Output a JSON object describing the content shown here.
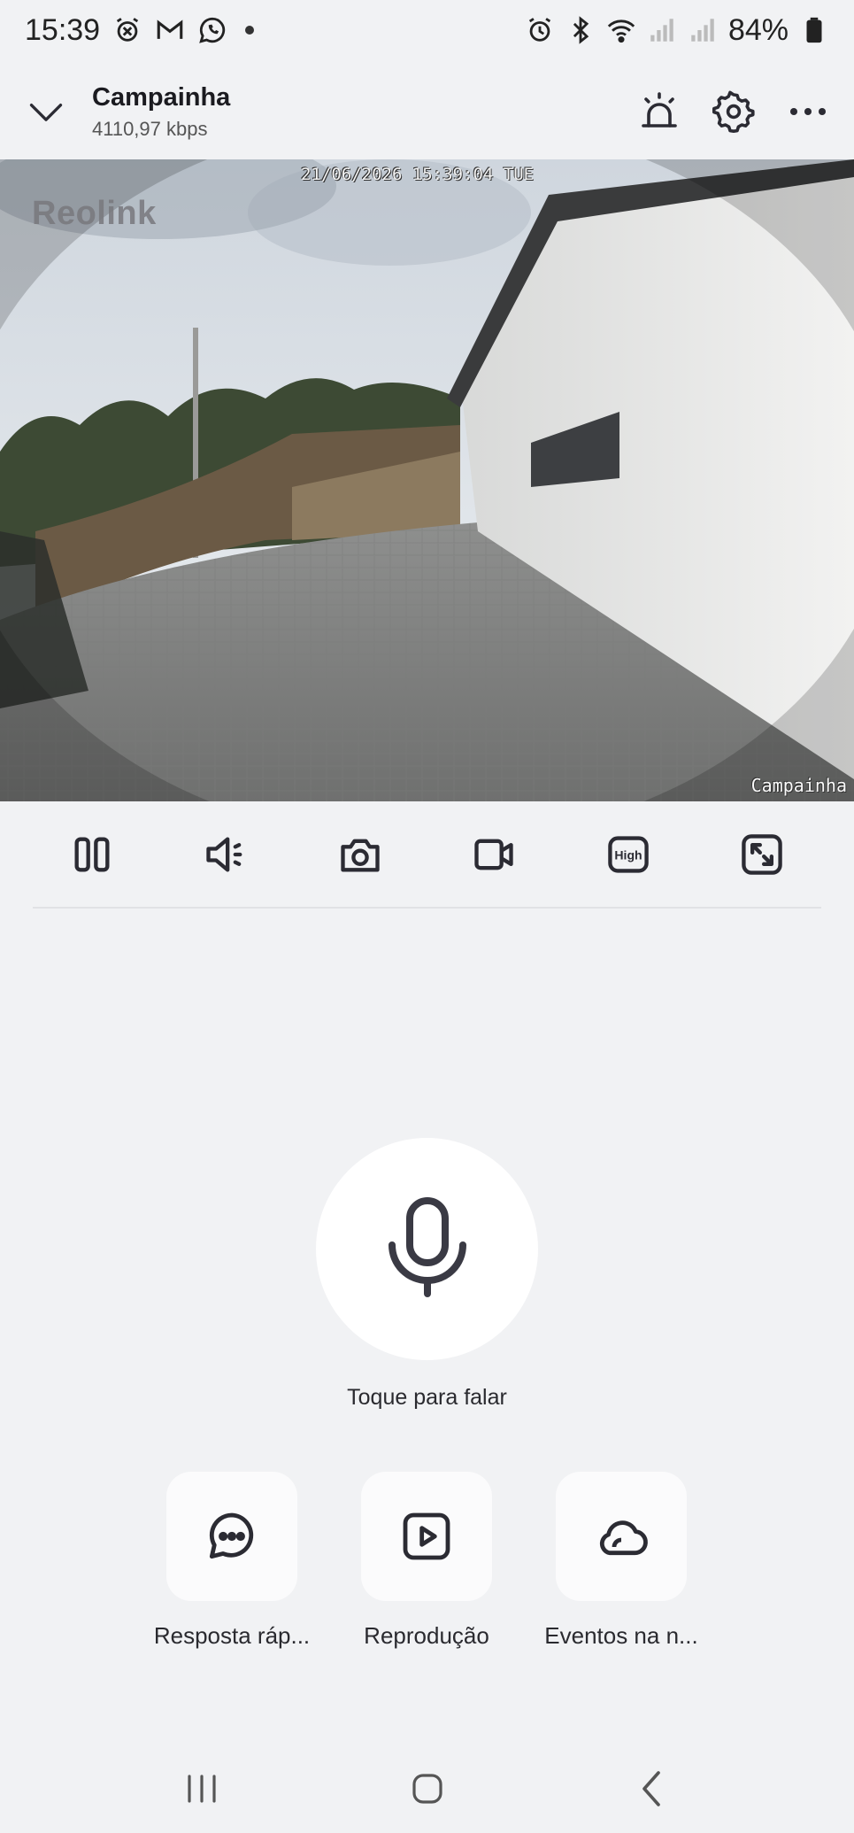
{
  "status_bar": {
    "time": "15:39",
    "battery": "84%",
    "left_icons": [
      "alarm-off-icon",
      "gmail-icon",
      "whatsapp-icon"
    ],
    "right_icons": [
      "alarm-icon",
      "bluetooth-icon",
      "wifi-icon",
      "signal-icon",
      "signal-icon",
      "battery-icon"
    ]
  },
  "header": {
    "title": "Campainha",
    "bitrate": "4110,97 kbps",
    "actions": [
      "siren-icon",
      "settings-icon",
      "more-icon"
    ]
  },
  "video": {
    "timestamp": "21/06/2026 15:39:04 TUE",
    "brand": "Reolink",
    "camera_name": "Campainha"
  },
  "toolbar": {
    "buttons": [
      "pause",
      "mute",
      "snapshot",
      "record",
      "quality",
      "fullscreen"
    ],
    "quality_label": "High"
  },
  "talk": {
    "label": "Toque para falar"
  },
  "quick_actions": [
    {
      "label": "Resposta ráp...",
      "icon": "chat-bubble-icon"
    },
    {
      "label": "Reprodução",
      "icon": "play-icon"
    },
    {
      "label": "Eventos na n...",
      "icon": "cloud-icon"
    }
  ],
  "colors": {
    "background": "#f1f2f4",
    "icon": "#2b2b33",
    "tile": "#fbfbfc"
  }
}
